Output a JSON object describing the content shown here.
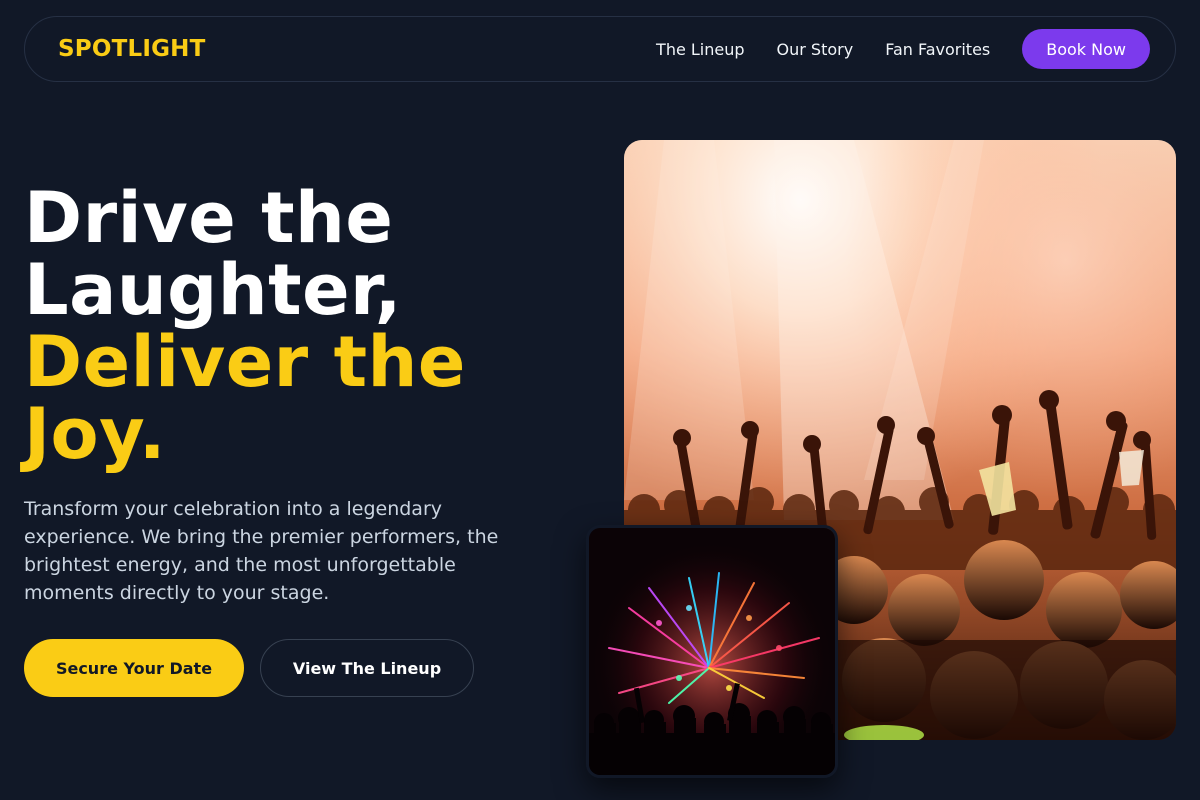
{
  "nav": {
    "logo": "SPOTLIGHT",
    "links": [
      {
        "label": "The Lineup"
      },
      {
        "label": "Our Story"
      },
      {
        "label": "Fan Favorites"
      }
    ],
    "cta_label": "Book Now"
  },
  "hero": {
    "title_lines": [
      "Drive the",
      "Laughter,",
      "Deliver the",
      "Joy."
    ],
    "subtitle": "Transform your celebration into a legendary experience. We bring the premier performers, the brightest energy, and the most unforgettable moments directly to your stage.",
    "primary_cta": "Secure Your Date",
    "secondary_cta": "View The Lineup"
  },
  "images": {
    "main": "concert-crowd-photo",
    "inset": "fireworks-crowd-photo"
  },
  "colors": {
    "background": "#111827",
    "accent": "#facc15",
    "brand_purple": "#7c3aed",
    "muted_text": "#cbd5e1"
  }
}
